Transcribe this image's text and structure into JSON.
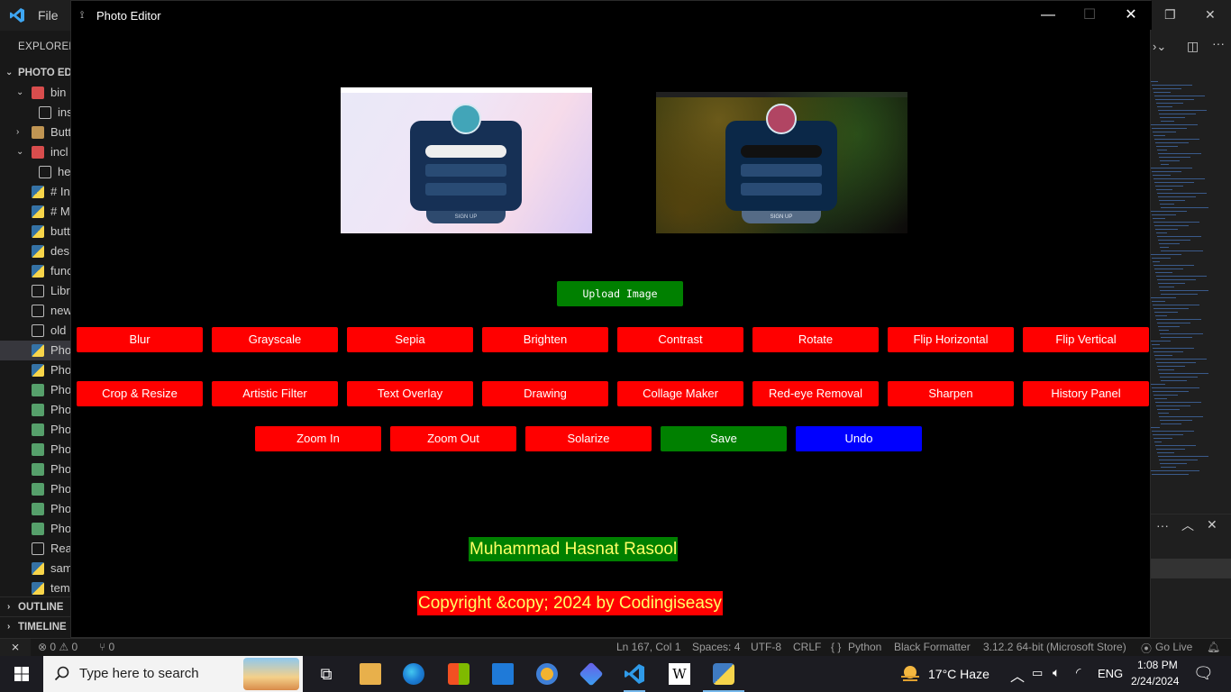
{
  "vscode": {
    "menu_file": "File",
    "explorer_title": "EXPLORER",
    "tree": [
      {
        "label": "PHOTO EDI",
        "icon": "folder",
        "indent": 0
      },
      {
        "label": "bin",
        "icon": "folder-red"
      },
      {
        "label": "ins",
        "icon": "doc"
      },
      {
        "label": "Butt",
        "icon": "folder"
      },
      {
        "label": "incl",
        "icon": "folder-red"
      },
      {
        "label": "he",
        "icon": "doc"
      },
      {
        "label": "# In",
        "icon": "py"
      },
      {
        "label": "# M",
        "icon": "py"
      },
      {
        "label": "butt",
        "icon": "py"
      },
      {
        "label": "des",
        "icon": "py"
      },
      {
        "label": "func",
        "icon": "py"
      },
      {
        "label": "Libr",
        "icon": "doc"
      },
      {
        "label": "new",
        "icon": "doc"
      },
      {
        "label": "old",
        "icon": "doc"
      },
      {
        "label": "Pho",
        "icon": "py"
      },
      {
        "label": "Pho",
        "icon": "py"
      },
      {
        "label": "Pho",
        "icon": "img"
      },
      {
        "label": "Pho",
        "icon": "img"
      },
      {
        "label": "Pho",
        "icon": "img"
      },
      {
        "label": "Pho",
        "icon": "img"
      },
      {
        "label": "Pho",
        "icon": "img"
      },
      {
        "label": "Pho",
        "icon": "img"
      },
      {
        "label": "Pho",
        "icon": "img"
      },
      {
        "label": "Pho",
        "icon": "img"
      },
      {
        "label": "Rea",
        "icon": "doc"
      },
      {
        "label": "sam",
        "icon": "py"
      },
      {
        "label": "tem",
        "icon": "py"
      }
    ],
    "outline": "OUTLINE",
    "timeline": "TIMELINE",
    "status": {
      "problems": "⊗ 0 ⚠ 0",
      "ports": "⑂ 0",
      "position": "Ln 167, Col 1",
      "spaces": "Spaces: 4",
      "encoding": "UTF-8",
      "eol": "CRLF",
      "language": "Python",
      "formatter": "Black Formatter",
      "interpreter": "3.12.2 64-bit (Microsoft Store)",
      "golive": "Go Live"
    }
  },
  "photo_editor": {
    "title": "Photo Editor",
    "preview": {
      "signup_label": "SIGN UP"
    },
    "upload_button": "Upload Image",
    "row1": [
      "Blur",
      "Grayscale",
      "Sepia",
      "Brighten",
      "Contrast",
      "Rotate",
      "Flip Horizontal",
      "Flip Vertical"
    ],
    "row2": [
      "Crop & Resize",
      "Artistic Filter",
      "Text Overlay",
      "Drawing",
      "Collage Maker",
      "Red-eye Removal",
      "Sharpen",
      "History Panel"
    ],
    "row3": [
      {
        "label": "Zoom In",
        "color": "#ff0000"
      },
      {
        "label": "Zoom Out",
        "color": "#ff0000"
      },
      {
        "label": "Solarize",
        "color": "#ff0000"
      },
      {
        "label": "Save",
        "color": "#008000"
      },
      {
        "label": "Undo",
        "color": "#0000ff"
      }
    ],
    "author": "Muhammad Hasnat Rasool",
    "copyright": "Copyright &copy; 2024 by Codingiseasy"
  },
  "taskbar": {
    "search_placeholder": "Type here to search",
    "weather": "17°C  Haze",
    "language": "ENG",
    "time": "1:08 PM",
    "date": "2/24/2024"
  }
}
